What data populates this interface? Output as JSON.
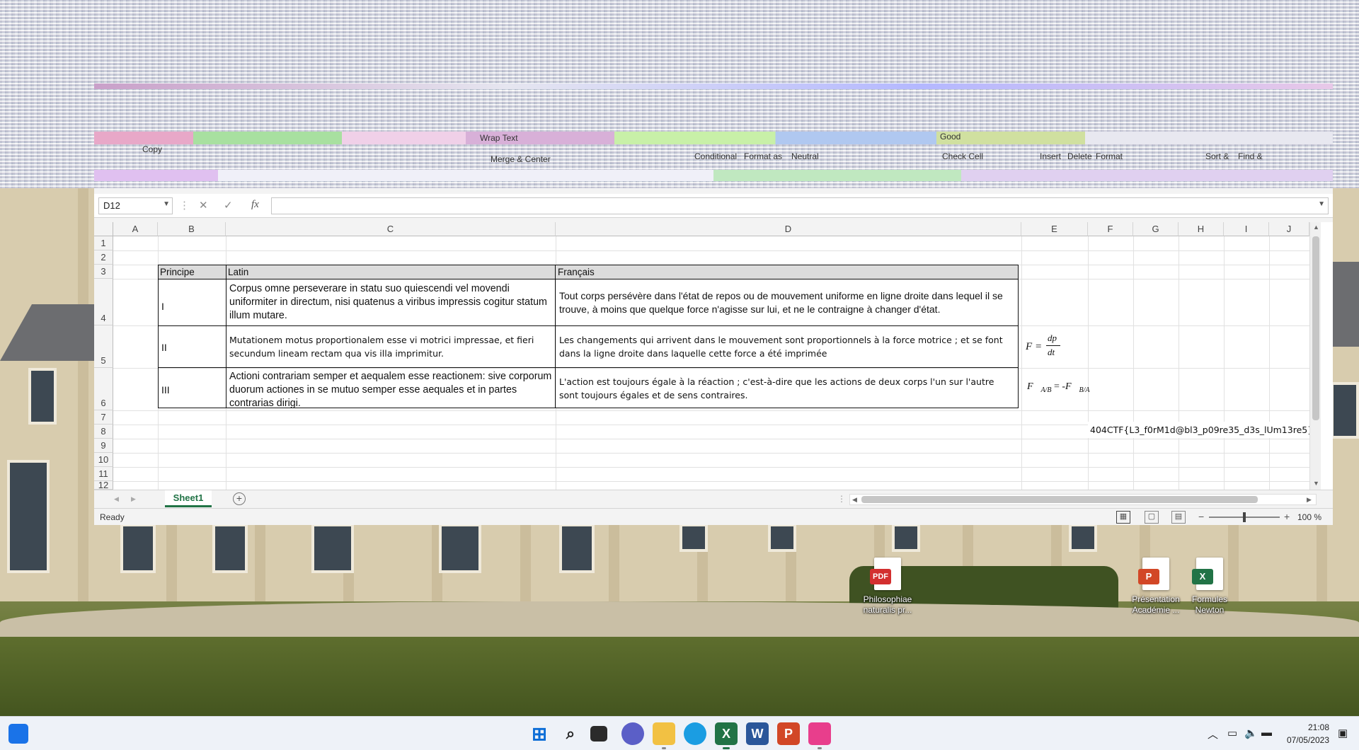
{
  "colors": {
    "excel_green": "#217346",
    "header_fill": "#dcdcdc",
    "taskbar": "#eef2f8"
  },
  "ribbon": {
    "labels": [
      "Wrap Text",
      "Good",
      "Conditional",
      "Format as",
      "Neutral",
      "Check Cell",
      "Insert",
      "Delete",
      "Format",
      "Sort &",
      "Find &",
      "Copy",
      "Merge & Center"
    ]
  },
  "formula_bar": {
    "name_box": "D12",
    "cancel_icon": "✕",
    "enter_icon": "✓",
    "fx_label": "fx",
    "value": ""
  },
  "grid": {
    "columns": [
      "A",
      "B",
      "C",
      "D",
      "E",
      "F",
      "G",
      "H",
      "I",
      "J"
    ],
    "rows": [
      "1",
      "2",
      "3",
      "4",
      "5",
      "6",
      "7",
      "8",
      "9",
      "10",
      "11",
      "12"
    ],
    "table": {
      "headers": [
        "Principe",
        "Latin",
        "Français"
      ],
      "rows": [
        {
          "principe": "I",
          "latin": "Corpus omne perseverare in statu suo quiescendi vel movendi uniformiter in directum, nisi quatenus a viribus impressis cogitur statum illum mutare.",
          "francais": " Tout corps persévère dans l'état de repos ou de mouvement uniforme en ligne droite dans lequel il se trouve, à moins que quelque force n'agisse sur lui, et ne le contraigne à changer d'état.",
          "formula": ""
        },
        {
          "principe": "II",
          "latin": "Mutationem motus proportionalem esse vi motrici impressae, et fieri secundum lineam rectam qua vis illa imprimitur.",
          "francais": "Les changements qui arrivent dans le mouvement sont proportionnels à la force motrice ; et se font dans la ligne droite dans laquelle cette force a été imprimée",
          "formula": "F = dp/dt"
        },
        {
          "principe": "III",
          "latin": "Actioni contrariam semper et aequalem esse reactionem: sive corporum duorum actiones in se mutuo semper esse aequales et in partes contrarias dirigi.",
          "francais": "L'action est toujours égale à la réaction ; c'est-à-dire que les actions de deux corps l'un sur l'autre sont toujours égales et de sens contraires.",
          "formula": "F A/B = -F B/A"
        }
      ]
    },
    "f8_value": "404CTF{L3_f0rM1d@bl3_p09re35_d3s_lUm13re5}"
  },
  "sheet_tabs": {
    "active": "Sheet1",
    "add_label": "+"
  },
  "status_bar": {
    "state": "Ready",
    "zoom": "100 %"
  },
  "desktop_icons": [
    {
      "label": "Philosophiae naturalis pr...",
      "badge": "PDF",
      "color": "#d32f2f"
    },
    {
      "label": "Présentation Académie ...",
      "badge": "P",
      "color": "#d24726"
    },
    {
      "label": "Formules Newton",
      "badge": "X",
      "color": "#217346"
    }
  ],
  "taskbar": {
    "clock_time": "21:08",
    "clock_date": "07/05/2023"
  }
}
